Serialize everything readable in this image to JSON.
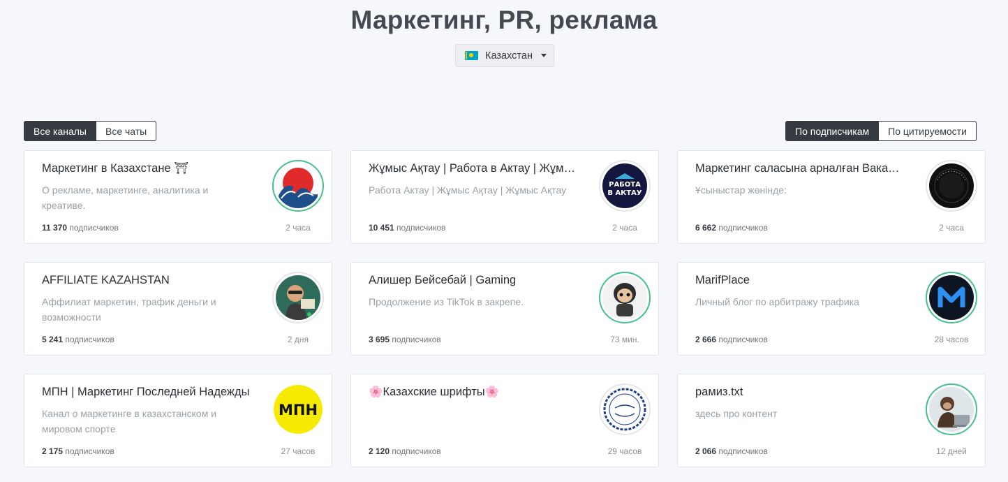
{
  "page": {
    "title": "Маркетинг, PR, реклама"
  },
  "country_select": {
    "value": "Казахстан",
    "flag": "kazakhstan-flag-icon"
  },
  "filters": {
    "channels_label": "Все каналы",
    "chats_label": "Все чаты",
    "active": "channels"
  },
  "sort": {
    "by_subscribers_label": "По подписчикам",
    "by_citations_label": "По цитируемости",
    "active": "subscribers"
  },
  "subscribers_suffix": "подписчиков",
  "cards": [
    {
      "title": "Маркетинг в Казахстане ⛩",
      "desc": "О рекламе, маркетинге, аналитика и креативе.",
      "subs": "11 370",
      "time": "2 часа",
      "avatar": "wave-icon"
    },
    {
      "title": "Жұмыс Ақтау | Работа в Актау | Жұмыс Ақтау",
      "desc": "Работа Актау | Жұмыс Ақтау | Жұмыс Ақтау",
      "subs": "10 451",
      "time": "2 часа",
      "avatar": "rabota-aktau-logo"
    },
    {
      "title": "Маркетинг саласына арналған Вакансиялар",
      "desc": "Ұсыныстар жөнінде:",
      "subs": "6 662",
      "time": "2 часа",
      "avatar": "vakansii-logo"
    },
    {
      "title": "AFFILIATE KAZAHSTAN",
      "desc": "Аффилиат маркетин, трафик деньги и возможности",
      "subs": "5 241",
      "time": "2 дня",
      "avatar": "person-cartoon-icon"
    },
    {
      "title": "Алишер Бейсебай | Gaming",
      "desc": "Продолжение из TikTok в закрепе.",
      "subs": "3 695",
      "time": "73 мин.",
      "avatar": "gamer-figure-icon"
    },
    {
      "title": "MarifPlace",
      "desc": "Личный блог по арбитражу трафика",
      "subs": "2 666",
      "time": "28 часов",
      "avatar": "m-logo"
    },
    {
      "title": "МПН | Маркетинг Последней Надежды",
      "desc": "Канал о маркетинге в казахстанском и мировом спорте",
      "subs": "2 175",
      "time": "27 часов",
      "avatar": "mpn-logo"
    },
    {
      "title": "🌸Казахские шрифты🌸",
      "desc": "",
      "subs": "2 120",
      "time": "29 часов",
      "avatar": "fonts-logo"
    },
    {
      "title": "рамиз.txt",
      "desc": "здесь про контент",
      "subs": "2 066",
      "time": "12 дней",
      "avatar": "monkey-laptop-icon"
    }
  ]
}
